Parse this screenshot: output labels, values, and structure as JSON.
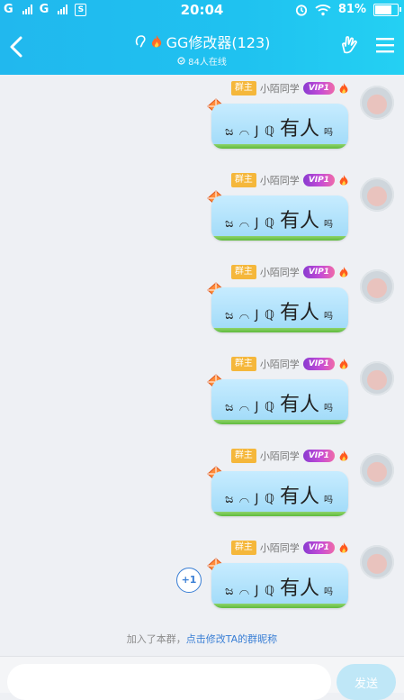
{
  "status_bar": {
    "carrier1": "G",
    "carrier2": "G",
    "sim_label": "S",
    "time": "20:04",
    "battery": "81%",
    "battery_level": 0.81
  },
  "header": {
    "title": "GG修改器(123)",
    "online": "84人在线",
    "icons": [
      "back-chevron-icon",
      "ear-icon",
      "fire-icon",
      "hand-icon",
      "menu-icon"
    ]
  },
  "messages": [
    {
      "role": "群主",
      "nick": "小陌同学",
      "vip": "VIP1",
      "symbols": "ಜ ⌒ J ℚ",
      "big": "有人",
      "small": "吗"
    },
    {
      "role": "群主",
      "nick": "小陌同学",
      "vip": "VIP1",
      "symbols": "ಜ ⌒ J ℚ",
      "big": "有人",
      "small": "吗"
    },
    {
      "role": "群主",
      "nick": "小陌同学",
      "vip": "VIP1",
      "symbols": "ಜ ⌒ J ℚ",
      "big": "有人",
      "small": "吗"
    },
    {
      "role": "群主",
      "nick": "小陌同学",
      "vip": "VIP1",
      "symbols": "ಜ ⌒ J ℚ",
      "big": "有人",
      "small": "吗"
    },
    {
      "role": "群主",
      "nick": "小陌同学",
      "vip": "VIP1",
      "symbols": "ಜ ⌒ J ℚ",
      "big": "有人",
      "small": "吗"
    },
    {
      "role": "群主",
      "nick": "小陌同学",
      "vip": "VIP1",
      "symbols": "ಜ ⌒ J ℚ",
      "big": "有人",
      "small": "吗"
    }
  ],
  "plus_one": "+1",
  "system_message": {
    "prefix": "加入了本群，",
    "link": "点击修改TA的群昵称"
  },
  "input_bar": {
    "placeholder": "",
    "send_label": "发送"
  },
  "colors": {
    "header": "#21b8ee",
    "link": "#3a7fd5",
    "owner_badge": "#f5b73b"
  }
}
